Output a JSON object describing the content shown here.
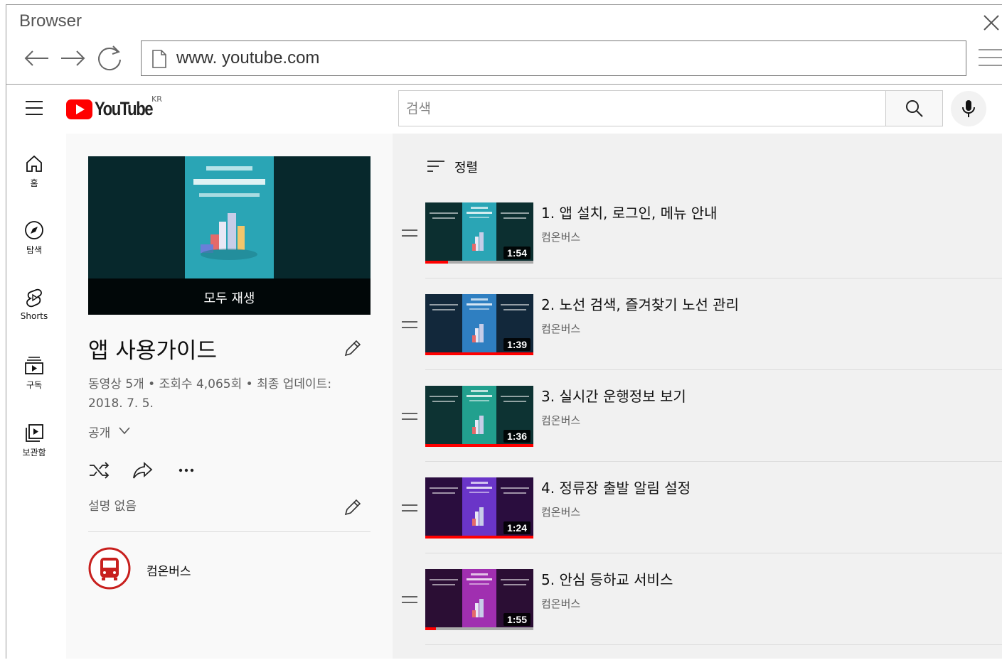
{
  "browser": {
    "title": "Browser",
    "url": "www. youtube.com"
  },
  "youtube": {
    "logo_text": "YouTube",
    "region": "KR",
    "search_placeholder": "검색"
  },
  "sidebar": {
    "items": [
      {
        "label": "홈",
        "icon": "home-icon"
      },
      {
        "label": "탐색",
        "icon": "compass-icon"
      },
      {
        "label": "Shorts",
        "icon": "shorts-icon"
      },
      {
        "label": "구독",
        "icon": "subscriptions-icon"
      },
      {
        "label": "보관함",
        "icon": "library-icon"
      }
    ]
  },
  "playlist": {
    "play_all": "모두 재생",
    "title": "앱 사용가이드",
    "meta": "동영상 5개 • 조회수 4,065회 • 최종 업데이트: 2018. 7. 5.",
    "privacy": "공개",
    "description": "설명 없음",
    "owner": "컴온버스"
  },
  "videos": {
    "sort_label": "정렬",
    "items": [
      {
        "title": "1. 앱 설치, 로그인, 메뉴 안내",
        "channel": "컴온버스",
        "duration": "1:54",
        "progress": 0.21,
        "bg": "#0c2f30",
        "card": "#2aa5b5"
      },
      {
        "title": "2. 노선 검색, 즐겨찾기 노선 관리",
        "channel": "컴온버스",
        "duration": "1:39",
        "progress": 1.0,
        "bg": "#12283b",
        "card": "#2f7fc1"
      },
      {
        "title": "3. 실시간 운행정보 보기",
        "channel": "컴온버스",
        "duration": "1:36",
        "progress": 1.0,
        "bg": "#0d3333",
        "card": "#22a08e"
      },
      {
        "title": "4. 정류장 출발 알림 설정",
        "channel": "컴온버스",
        "duration": "1:24",
        "progress": 1.0,
        "bg": "#2a0d3e",
        "card": "#6a35c8"
      },
      {
        "title": "5. 안심 등하교 서비스",
        "channel": "컴온버스",
        "duration": "1:55",
        "progress": 0.1,
        "bg": "#2b0e34",
        "card": "#a02fb0"
      }
    ]
  },
  "colors": {
    "yt_red": "#ff0000",
    "progress": "#ff0000",
    "avatar_red": "#c8201e"
  }
}
